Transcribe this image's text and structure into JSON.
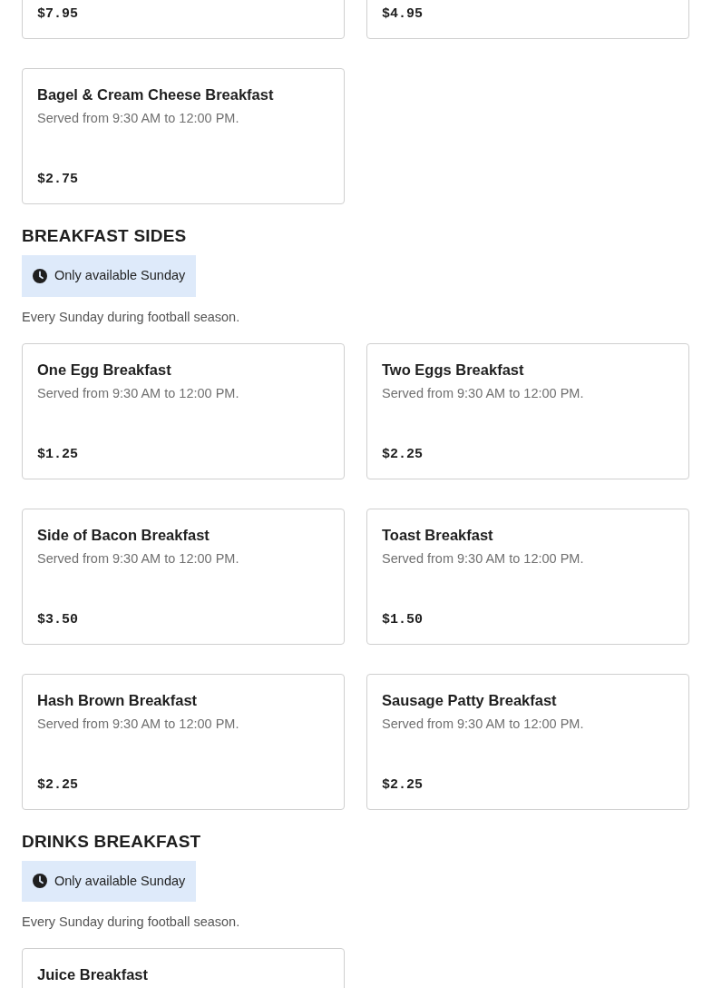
{
  "sections": [
    {
      "items": [
        {
          "price": "$7.95"
        },
        {
          "price": "$4.95"
        },
        {
          "name": "Bagel & Cream Cheese Breakfast",
          "description": "Served from 9:30 AM to 12:00 PM.",
          "price": "$2.75"
        }
      ]
    },
    {
      "title": "BREAKFAST SIDES",
      "availability": "Only available Sunday",
      "note": "Every Sunday during football season.",
      "items": [
        {
          "name": "One Egg Breakfast",
          "description": "Served from 9:30 AM to 12:00 PM.",
          "price": "$1.25"
        },
        {
          "name": "Two Eggs Breakfast",
          "description": "Served from 9:30 AM to 12:00 PM.",
          "price": "$2.25"
        },
        {
          "name": "Side of Bacon Breakfast",
          "description": "Served from 9:30 AM to 12:00 PM.",
          "price": "$3.50"
        },
        {
          "name": "Toast Breakfast",
          "description": "Served from 9:30 AM to 12:00 PM.",
          "price": "$1.50"
        },
        {
          "name": "Hash Brown Breakfast",
          "description": "Served from 9:30 AM to 12:00 PM.",
          "price": "$2.25"
        },
        {
          "name": "Sausage Patty Breakfast",
          "description": "Served from 9:30 AM to 12:00 PM.",
          "price": "$2.25"
        }
      ]
    },
    {
      "title": "DRINKS BREAKFAST",
      "availability": "Only available Sunday",
      "note": "Every Sunday during football season.",
      "items": [
        {
          "name": "Juice Breakfast"
        }
      ]
    }
  ]
}
